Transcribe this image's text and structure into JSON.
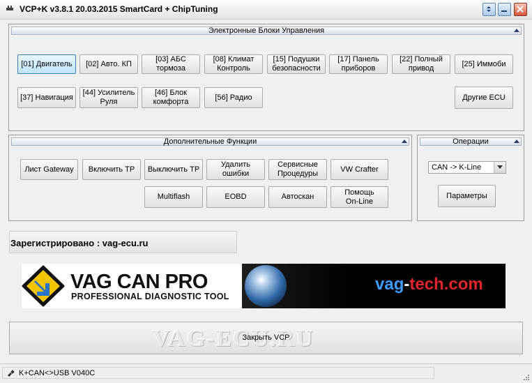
{
  "window": {
    "title": "VCP+K v3.8.1 20.03.2015 SmartCard + ChipTuning",
    "icon": "plug-icon",
    "controls": [
      "restore-icon",
      "minimize-icon",
      "close-icon"
    ]
  },
  "ecu_panel": {
    "header": "Электронные Блоки Управления",
    "buttons": [
      {
        "label": "[01] Двигатель",
        "selected": true
      },
      {
        "label": "[02] Авто. КП"
      },
      {
        "label": "[03] АБС\nтормоза"
      },
      {
        "label": "[08] Климат\nКонтроль"
      },
      {
        "label": "[15] Подушки\nбезопасности"
      },
      {
        "label": "[17] Панель\nприборов"
      },
      {
        "label": "[22] Полный\nпривод"
      },
      {
        "label": "[25] Иммоби"
      },
      {
        "label": "[37] Навигация"
      },
      {
        "label": "[44] Усилитель\nРуля"
      },
      {
        "label": "[46] Блок\nкомфорта"
      },
      {
        "label": "[56] Радио"
      },
      {
        "label": "Другие ECU"
      }
    ]
  },
  "functions_panel": {
    "header": "Дополнительные Функции",
    "buttons": [
      {
        "label": "Лист Gateway"
      },
      {
        "label": "Включить TP"
      },
      {
        "label": "Выключить TP"
      },
      {
        "label": "Удалить\nошибки"
      },
      {
        "label": "Сервисные\nПроцедуры"
      },
      {
        "label": "VW Crafter"
      },
      {
        "label": "Multiflash"
      },
      {
        "label": "EOBD"
      },
      {
        "label": "Автоскан"
      },
      {
        "label": "Помощь\nOn-Line"
      }
    ]
  },
  "operations_panel": {
    "header": "Операции",
    "protocol_value": "CAN -> K-Line",
    "params_label": "Параметры"
  },
  "registration": "Зарегистрировано : vag-ecu.ru",
  "banner": {
    "brand": "VAG CAN PRO",
    "tagline": "PROFESSIONAL DIAGNOSTIC TOOL",
    "site_part1": "vag",
    "site_part2": "-",
    "site_part3": "tech.com",
    "accent_yellow": "#f5c400",
    "accent_blue": "#3f9bff",
    "accent_red": "#e0242c"
  },
  "close_button": {
    "label": "Закрыть VCP",
    "watermark": "VAG-ECU.RU"
  },
  "status": {
    "text": "K+CAN<>USB V040C",
    "icon": "usb-plug-icon"
  }
}
